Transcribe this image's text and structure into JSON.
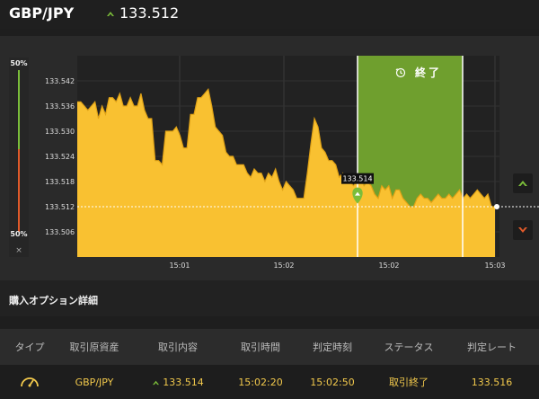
{
  "header": {
    "pair": "GBP/JPY",
    "rate": "133.512"
  },
  "gauge": {
    "top_percent": "50%",
    "bottom_percent": "50%",
    "close_glyph": "×"
  },
  "chart_data": {
    "type": "area",
    "ylim": [
      133.5,
      133.548
    ],
    "y_ticks": [
      "133.542",
      "133.536",
      "133.530",
      "133.524",
      "133.518",
      "133.512",
      "133.506"
    ],
    "x_ticks": [
      "15:01",
      "15:02",
      "15:02",
      "15:03"
    ],
    "current_rate_label": "133.512",
    "entry_marker_label": "133.514",
    "expiry_label": "終了",
    "colors": {
      "area": "#f9c131",
      "line": "#e0a216",
      "window": "#6f9f2e",
      "up": "#7bbd3a",
      "down": "#e05a2a"
    },
    "series": [
      {
        "values": [
          133.537,
          133.537,
          133.536,
          133.535,
          133.536,
          133.537,
          133.533,
          133.536,
          133.534,
          133.538,
          133.538,
          133.537,
          133.539,
          133.536,
          133.536,
          133.538,
          133.536,
          133.536,
          133.539,
          133.535,
          133.533,
          133.533,
          133.523,
          133.523,
          133.522,
          133.53,
          133.53,
          133.53,
          133.531,
          133.529,
          133.526,
          133.526,
          133.534,
          133.534,
          133.538,
          133.538,
          133.539,
          133.54,
          133.536,
          133.531,
          133.53,
          133.529,
          133.525,
          133.524,
          133.524,
          133.522,
          133.522,
          133.522,
          133.52,
          133.519,
          133.521,
          133.52,
          133.52,
          133.518,
          133.52,
          133.519,
          133.521,
          133.518,
          133.516,
          133.518,
          133.517,
          133.516,
          133.514,
          133.514,
          133.514,
          133.52,
          133.527,
          133.533,
          133.531,
          133.526,
          133.525,
          133.523,
          133.523,
          133.522,
          133.519,
          133.52,
          133.518,
          133.518,
          133.517,
          133.518,
          133.519,
          133.517,
          133.518,
          133.517,
          133.515,
          133.514,
          133.517,
          133.516,
          133.517,
          133.514,
          133.516,
          133.516,
          133.514,
          133.513,
          133.512,
          133.512,
          133.514,
          133.515,
          133.514,
          133.514,
          133.513,
          133.514,
          133.515,
          133.514,
          133.514,
          133.515,
          133.514,
          133.515,
          133.516,
          133.514,
          133.515,
          133.514,
          133.515,
          133.516,
          133.515,
          133.514,
          133.515,
          133.512,
          133.512
        ]
      }
    ]
  },
  "panel": {
    "title": "購入オプション詳細"
  },
  "table": {
    "headers": [
      "タイプ",
      "取引原資産",
      "取引内容",
      "取引時間",
      "判定時刻",
      "ステータス",
      "判定レート"
    ],
    "row": {
      "asset": "GBP/JPY",
      "content": "133.514",
      "trade_time": "15:02:20",
      "judge_time": "15:02:50",
      "status": "取引終了",
      "judge_rate": "133.516"
    }
  }
}
